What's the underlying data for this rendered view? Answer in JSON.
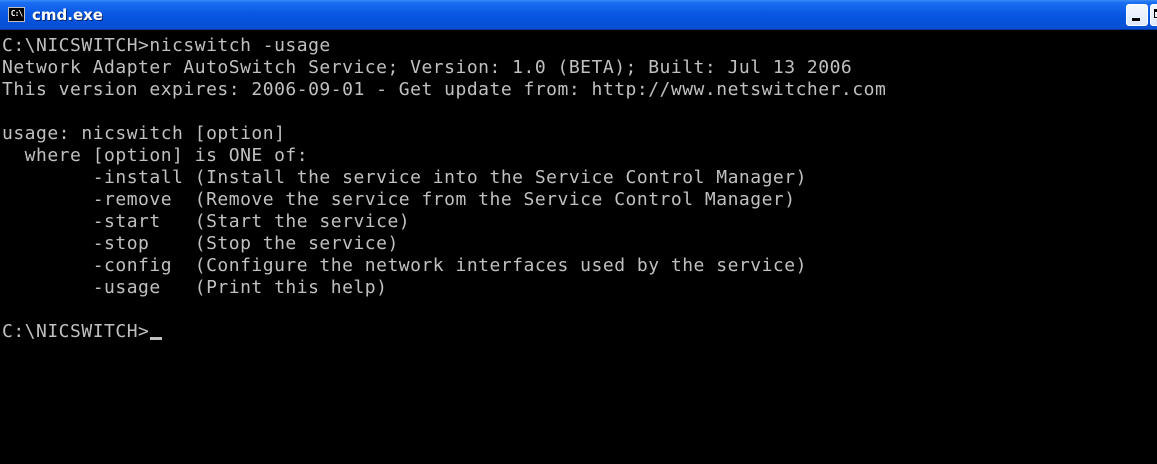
{
  "window": {
    "title": "cmd.exe",
    "icon": "console-icon",
    "icon_label": "C:\\"
  },
  "console": {
    "text_color": "#c0c0c0",
    "background_color": "#000000",
    "lines": [
      "C:\\NICSWITCH>nicswitch -usage",
      "Network Adapter AutoSwitch Service; Version: 1.0 (BETA); Built: Jul 13 2006",
      "This version expires: 2006-09-01 - Get update from: http://www.netswitcher.com",
      "",
      "usage: nicswitch [option]",
      "  where [option] is ONE of:",
      "        -install (Install the service into the Service Control Manager)",
      "        -remove  (Remove the service from the Service Control Manager)",
      "        -start   (Start the service)",
      "        -stop    (Stop the service)",
      "        -config  (Configure the network interfaces used by the service)",
      "        -usage   (Print this help)",
      ""
    ],
    "prompt": "C:\\NICSWITCH>"
  }
}
